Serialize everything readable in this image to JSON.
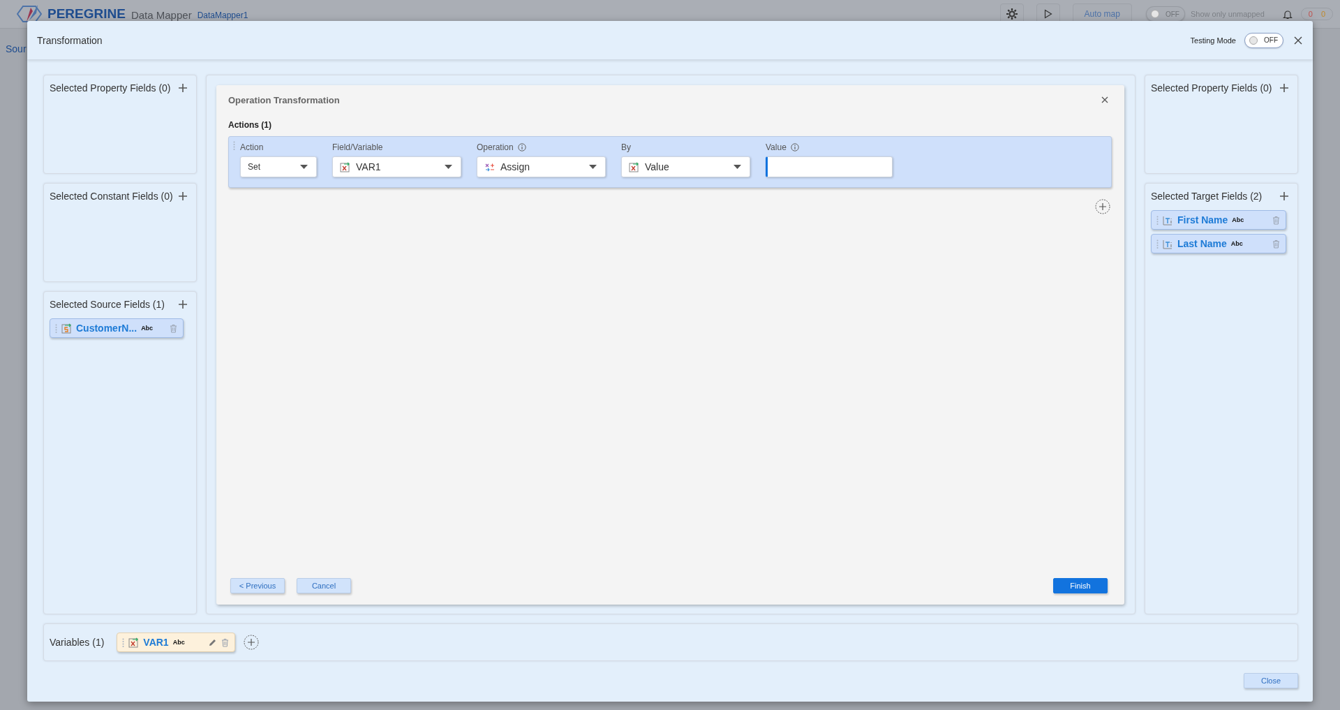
{
  "app_header": {
    "logo": "PEREGRINE",
    "product": "Data Mapper",
    "document": "DataMapper1",
    "auto_map": "Auto map",
    "unmapped_toggle": {
      "state": "OFF",
      "on": false
    },
    "unmapped_label": "Show only unmapped",
    "error_count": "0",
    "warning_count": "0",
    "side_link": "Sour"
  },
  "dialog": {
    "title": "Transformation",
    "testing_mode": {
      "label": "Testing Mode",
      "state": "OFF",
      "on": false
    }
  },
  "left_panels": [
    {
      "title": "Selected Property Fields (0)"
    },
    {
      "title": "Selected Constant Fields (0)"
    },
    {
      "title": "Selected Source Fields (1)",
      "fields": [
        {
          "name": "CustomerN...",
          "type": "Abc",
          "kind": "source"
        }
      ]
    }
  ],
  "operation": {
    "title": "Operation Transformation",
    "actions_label": "Actions (1)",
    "actions": [
      {
        "columns": [
          {
            "label": "Action",
            "kind": "plain",
            "value": "Set",
            "info": false
          },
          {
            "label": "Field/Variable",
            "kind": "variable",
            "value": "VAR1",
            "info": false
          },
          {
            "label": "Operation",
            "kind": "operation",
            "value": "Assign",
            "info": true
          },
          {
            "label": "By",
            "kind": "variable",
            "value": "Value",
            "info": false
          },
          {
            "label": "Value",
            "kind": "input",
            "info": true,
            "focused": true
          }
        ]
      }
    ],
    "buttons": [
      {
        "label": "< Previous",
        "kind": "secondary"
      },
      {
        "label": "Cancel",
        "kind": "secondary"
      },
      {
        "label": "Finish",
        "kind": "primary"
      }
    ]
  },
  "right_panels": [
    {
      "title": "Selected Property Fields (0)"
    },
    {
      "title": "Selected Target Fields (2)",
      "fields": [
        {
          "name": "First Name",
          "type": "Abc",
          "kind": "target"
        },
        {
          "name": "Last Name",
          "type": "Abc",
          "kind": "target"
        }
      ]
    }
  ],
  "variables": {
    "label": "Variables (1)",
    "items": [
      {
        "name": "VAR1",
        "type": "Abc",
        "kind": "variable"
      }
    ]
  },
  "close_button": "Close"
}
